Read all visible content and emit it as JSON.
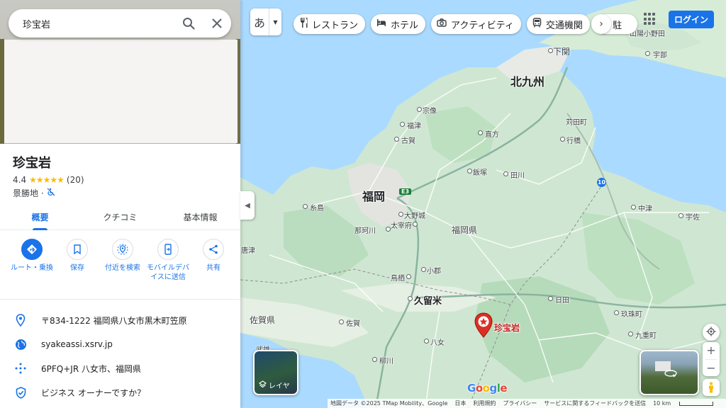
{
  "search": {
    "query": "珍宝岩"
  },
  "place": {
    "name": "珍宝岩",
    "rating": "4.4",
    "stars": "★★★★★",
    "reviews": "(20)",
    "category": "景勝地 ·"
  },
  "tabs": [
    {
      "label": "概要"
    },
    {
      "label": "クチコミ"
    },
    {
      "label": "基本情報"
    }
  ],
  "actions": [
    {
      "label": "ルート・乗換",
      "icon": "directions-icon"
    },
    {
      "label": "保存",
      "icon": "bookmark-icon"
    },
    {
      "label": "付近を検索",
      "icon": "nearby-icon"
    },
    {
      "label": "モバイルデバイスに送信",
      "icon": "send-to-phone-icon"
    },
    {
      "label": "共有",
      "icon": "share-icon"
    }
  ],
  "info": {
    "address": "〒834-1222 福岡県八女市黒木町笠原",
    "website": "syakeassi.xsrv.jp",
    "plus_code": "6PFQ+JR 八女市、福岡県",
    "claim": "ビジネス オーナーですか？"
  },
  "top": {
    "lang": "あ",
    "chips": [
      {
        "label": "レストラン",
        "icon": "restaurant-icon"
      },
      {
        "label": "ホテル",
        "icon": "hotel-icon"
      },
      {
        "label": "アクティビティ",
        "icon": "camera-icon"
      },
      {
        "label": "交通機関",
        "icon": "transit-icon"
      },
      {
        "label": "駐",
        "icon": "parking-icon"
      }
    ],
    "login": "ログイン"
  },
  "map": {
    "pin_label": "珍宝岩",
    "layers_label": "レイヤ",
    "google": "Google",
    "labels": {
      "yamaguchi_onoda": "山陽小野田",
      "ube": "宇部",
      "shimonoseki": "下関",
      "kitakyushu": "北九州",
      "munakata": "宗像",
      "fukutsu": "福津",
      "koga": "古賀",
      "nogata": "直方",
      "karita": "苅田町",
      "yukuhashi": "行橋",
      "iizuka": "飯塚",
      "tagawa": "田川",
      "fukuoka": "福岡",
      "itoshima": "糸島",
      "onojo": "大野城",
      "nakagawa": "那珂川",
      "dazaifu": "太宰府",
      "fukuoka_pref": "福岡県",
      "nakatsu": "中津",
      "usa": "宇佐",
      "tosu": "鳥栖",
      "ogori": "小郡",
      "kurume": "久留米",
      "hita": "日田",
      "saga_pref": "佐賀県",
      "saga": "佐賀",
      "yame": "八女",
      "kusu": "玖珠町",
      "kokonoe": "九重町",
      "yanagawa": "柳川",
      "takeo": "武雄",
      "karatsu_edge": "唐津",
      "e3": "E3",
      "r10": "10"
    },
    "attribution": {
      "data": "地図データ ©2025 TMap Mobility、Google",
      "japan": "日本",
      "terms": "利用規約",
      "privacy": "プライバシー",
      "feedback": "サービスに関するフィードバックを送信",
      "scale": "10 km"
    }
  },
  "colors": {
    "water": "#aadaff",
    "land": "#cde8d0",
    "accent": "#1a73e8",
    "pin": "#d93025"
  }
}
